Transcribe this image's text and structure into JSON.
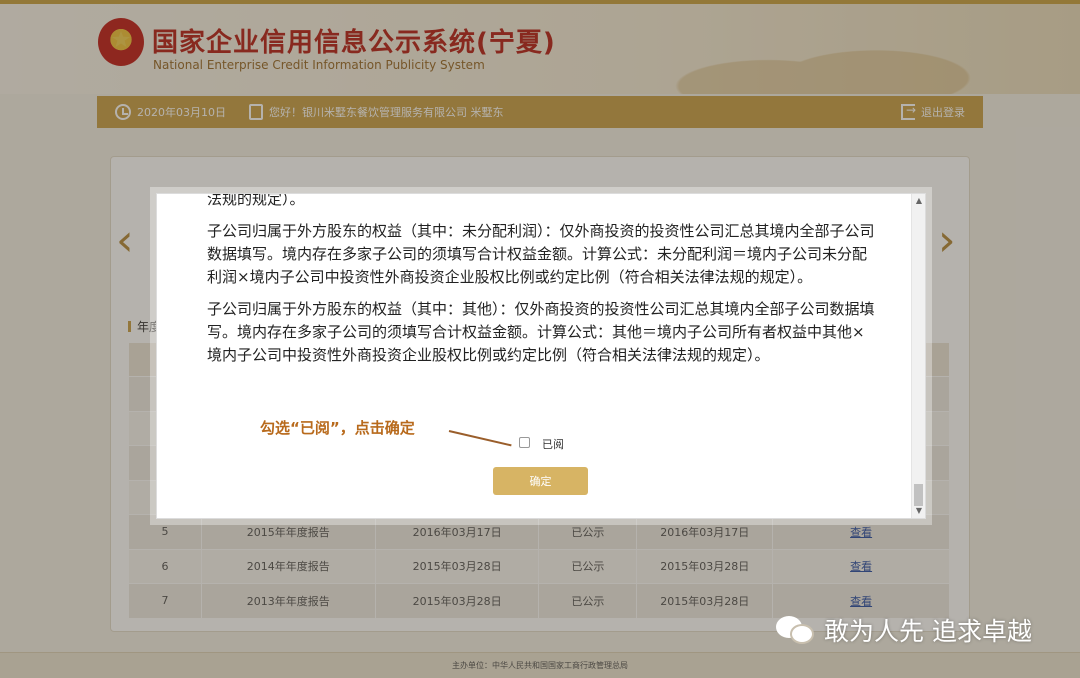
{
  "header": {
    "title": "国家企业信用信息公示系统(宁夏)",
    "subtitle": "National Enterprise Credit Information Publicity System"
  },
  "userbar": {
    "date": "2020年03月10日",
    "greeting": "您好！银川米墅东餐饮管理服务有限公司  米墅东",
    "logout": "退出登录"
  },
  "section": {
    "label": "年度"
  },
  "table": {
    "rows": [
      {
        "no": "5",
        "report": "2015年年度报告",
        "submit_date": "2016年03月17日",
        "status": "已公示",
        "publish_date": "2016年03月17日",
        "action": "查看"
      },
      {
        "no": "6",
        "report": "2014年年度报告",
        "submit_date": "2015年03月28日",
        "status": "已公示",
        "publish_date": "2015年03月28日",
        "action": "查看"
      },
      {
        "no": "7",
        "report": "2013年年度报告",
        "submit_date": "2015年03月28日",
        "status": "已公示",
        "publish_date": "2015年03月28日",
        "action": "查看"
      }
    ]
  },
  "footer": {
    "text": "主办单位：中华人民共和国国家工商行政管理总局"
  },
  "modal": {
    "para0": "法规的规定）。",
    "para1": "子公司归属于外方股东的权益（其中：未分配利润）：仅外商投资的投资性公司汇总其境内全部子公司数据填写。境内存在多家子公司的须填写合计权益金额。计算公式：未分配利润＝境内子公司未分配利润×境内子公司中投资性外商投资企业股权比例或约定比例（符合相关法律法规的规定）。",
    "para2": "子公司归属于外方股东的权益（其中：其他）：仅外商投资的投资性公司汇总其境内全部子公司数据填写。境内存在多家子公司的须填写合计权益金额。计算公式：其他＝境内子公司所有者权益中其他×境内子公司中投资性外商投资企业股权比例或约定比例（符合相关法律法规的规定）。",
    "annotation": "勾选“已阅”，点击确定",
    "checkbox_label": "已阅",
    "confirm_label": "确定"
  },
  "watermark": {
    "text": "敢为人先 追求卓越"
  },
  "colors": {
    "accent": "#c9a04a",
    "title_red": "#b6231a",
    "link": "#2b4fa6"
  }
}
